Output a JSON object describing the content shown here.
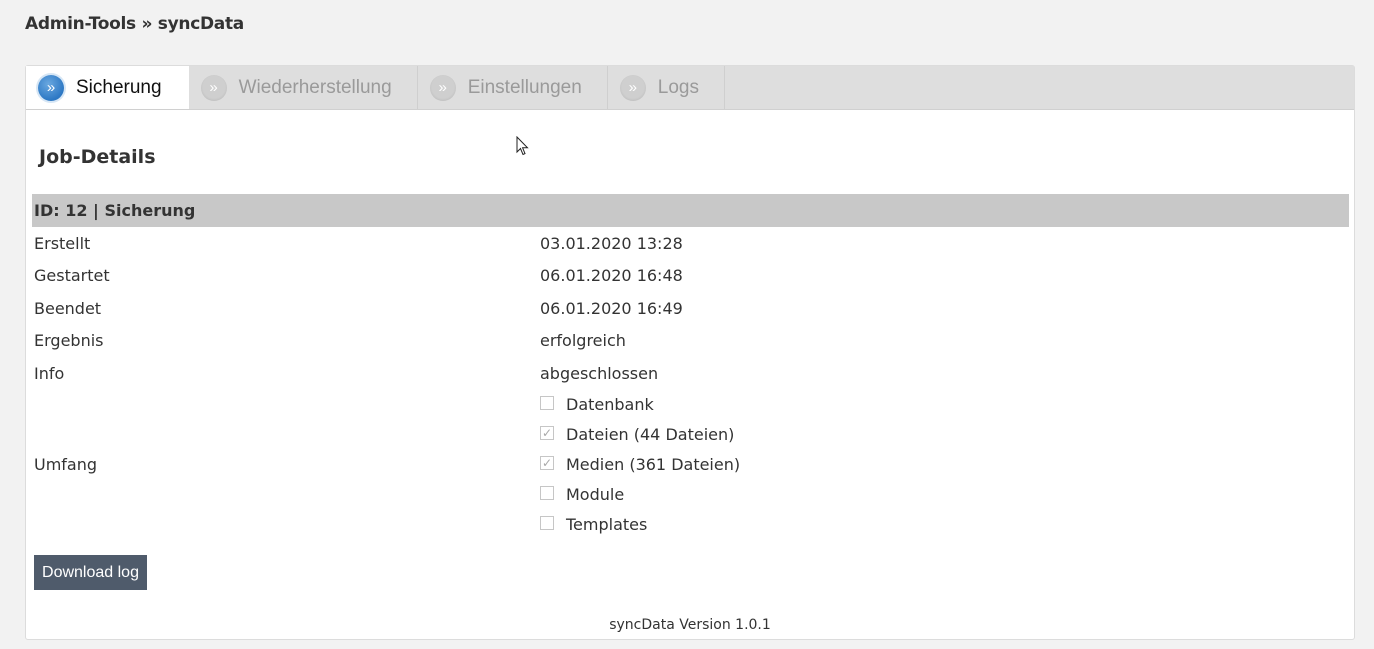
{
  "breadcrumb": "Admin-Tools » syncData",
  "tabs": [
    {
      "label": "Sicherung",
      "icon": "»",
      "active": true
    },
    {
      "label": "Wiederherstellung",
      "icon": "»",
      "active": false
    },
    {
      "label": "Einstellungen",
      "icon": "»",
      "active": false
    },
    {
      "label": "Logs",
      "icon": "»",
      "active": false
    }
  ],
  "section_title": "Job-Details",
  "job": {
    "header": "ID: 12 | Sicherung",
    "rows": [
      {
        "label": "Erstellt",
        "value": "03.01.2020 13:28"
      },
      {
        "label": "Gestartet",
        "value": "06.01.2020 16:48"
      },
      {
        "label": "Beendet",
        "value": "06.01.2020 16:49"
      },
      {
        "label": "Ergebnis",
        "value": "erfolgreich"
      },
      {
        "label": "Info",
        "value": "abgeschlossen"
      }
    ],
    "scope_label": "Umfang",
    "scope_items": [
      {
        "label": "Datenbank",
        "checked": false
      },
      {
        "label": "Dateien (44 Dateien)",
        "checked": true
      },
      {
        "label": "Medien (361 Dateien)",
        "checked": true
      },
      {
        "label": "Module",
        "checked": false
      },
      {
        "label": "Templates",
        "checked": false
      }
    ]
  },
  "download_button": "Download log",
  "footer": "syncData Version 1.0.1",
  "colors": {
    "active_tab_icon": "#2d78c4",
    "button_bg": "#4f5b6b",
    "header_row_bg": "#c8c8c8"
  }
}
